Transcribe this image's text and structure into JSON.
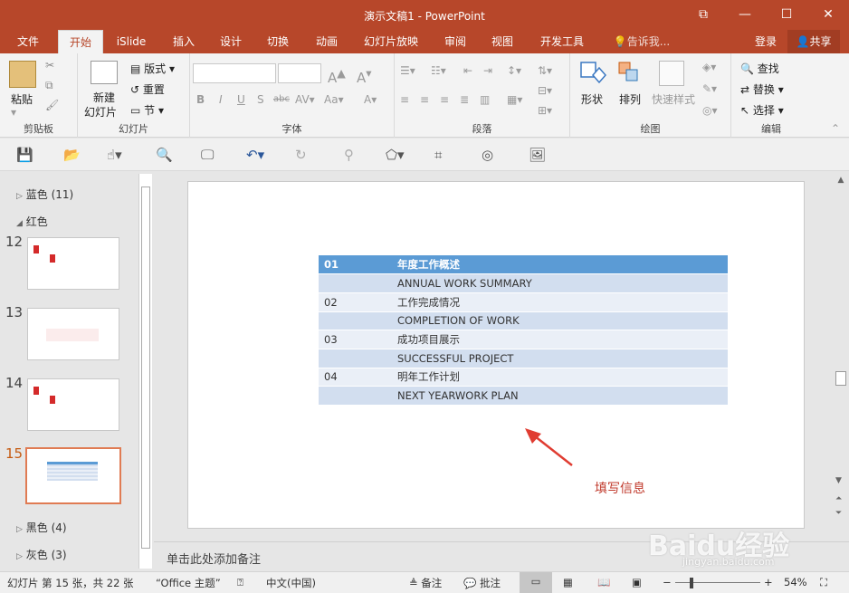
{
  "window": {
    "title": "演示文稿1 - PowerPoint"
  },
  "menu": {
    "tabs": [
      "文件",
      "开始",
      "iSlide",
      "插入",
      "设计",
      "切换",
      "动画",
      "幻灯片放映",
      "审阅",
      "视图",
      "开发工具"
    ],
    "tell_me": "告诉我...",
    "login": "登录",
    "share": "共享"
  },
  "ribbon": {
    "clipboard": {
      "paste": "粘贴",
      "label": "剪贴板"
    },
    "slides": {
      "new_slide": "新建",
      "new_slide2": "幻灯片",
      "layout": "版式",
      "reset": "重置",
      "section": "节",
      "label": "幻灯片"
    },
    "font": {
      "label": "字体"
    },
    "paragraph": {
      "label": "段落"
    },
    "drawing": {
      "shape": "形状",
      "arrange": "排列",
      "quick_style": "快速样式",
      "label": "绘图"
    },
    "editing": {
      "find": "查找",
      "replace": "替换",
      "select": "选择",
      "label": "编辑"
    }
  },
  "sections": {
    "blue": "蓝色 (11)",
    "red": "红色",
    "black": "黑色 (4)",
    "gray": "灰色 (3)"
  },
  "slides": [
    "12",
    "13",
    "14",
    "15"
  ],
  "table": {
    "header": [
      "01",
      "年度工作概述"
    ],
    "rows": [
      [
        "",
        "ANNUAL WORK SUMMARY"
      ],
      [
        "02",
        "工作完成情况"
      ],
      [
        "",
        "COMPLETION OF WORK"
      ],
      [
        "03",
        "成功项目展示"
      ],
      [
        "",
        "SUCCESSFUL PROJECT"
      ],
      [
        "04",
        "明年工作计划"
      ],
      [
        "",
        "NEXT YEARWORK PLAN"
      ]
    ]
  },
  "annotation": "填写信息",
  "notes_placeholder": "单击此处添加备注",
  "status": {
    "slide_info": "幻灯片 第 15 张，共 22 张",
    "theme": "“Office 主题”",
    "language": "中文(中国)",
    "notes": "备注",
    "comments": "批注",
    "zoom": "54%"
  },
  "watermark": {
    "brand": "Baidu经验",
    "url": "jingyan.baidu.com"
  },
  "colors": {
    "accent": "#b7472a",
    "table_header": "#5b9bd5",
    "row_dark": "#d2deef",
    "row_light": "#eaeff7",
    "arrow": "#e03c31"
  }
}
